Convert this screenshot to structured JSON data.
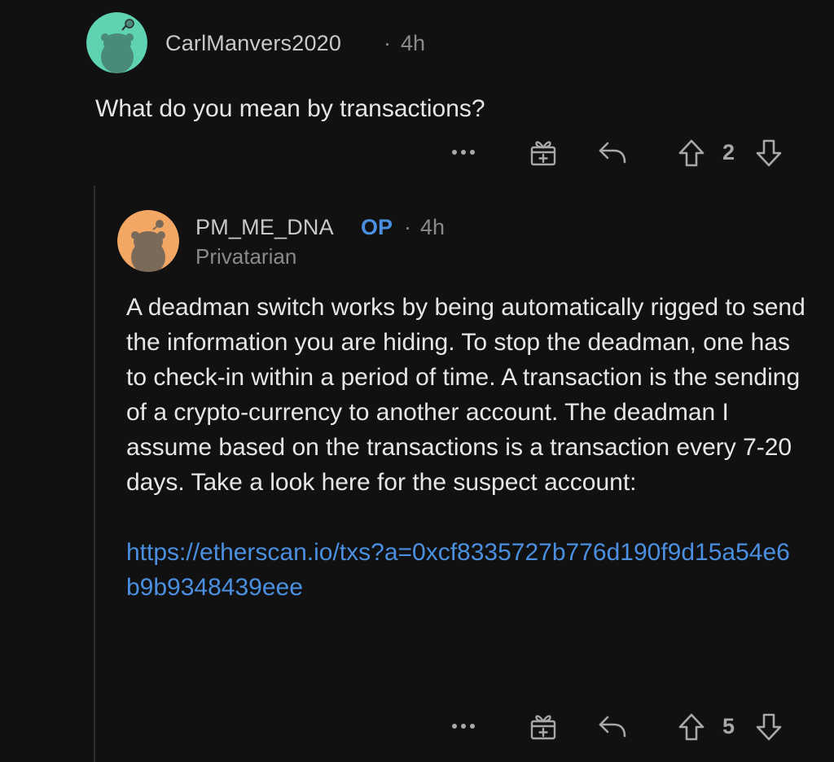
{
  "comments": [
    {
      "author": "CarlManvers2020",
      "separator": "·",
      "time": "4h",
      "body": "What do you mean by transactions?",
      "votes": "2",
      "avatar_color": "#5fd3b1"
    },
    {
      "author": "PM_ME_DNA",
      "op_badge": "OP",
      "separator": "·",
      "time": "4h",
      "flair": "Privatarian",
      "body": "A deadman switch works by being automatically rigged to send the information you are hiding. To stop the deadman, one has to check-in within a period of time. A transaction is the sending of a crypto-currency to another account. The deadman I assume based on the transactions is a transaction every 7-20 days. Take a look here for the suspect account:",
      "link": "https://etherscan.io/txs?a=0xcf8335727b776d190f9d15a54e6b9b9348439eee",
      "votes": "5",
      "avatar_color": "#f2a765"
    }
  ],
  "actions": {
    "more": "more-icon",
    "award": "gift-award-icon",
    "reply": "reply-arrow-icon",
    "upvote": "upvote-arrow-icon",
    "downvote": "downvote-arrow-icon"
  },
  "colors": {
    "background": "#111111",
    "op_accent": "#4a8fe0",
    "link": "#4a8fe0"
  }
}
